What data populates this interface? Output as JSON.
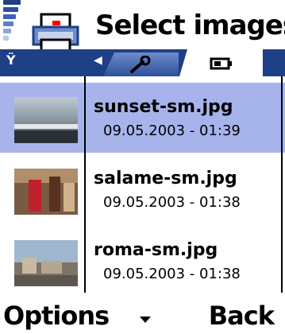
{
  "header": {
    "title": "Select images",
    "app_icon": "printer-icon",
    "signal_level": 0.8
  },
  "tabs": {
    "left_arrow_icon": "arrow-left-icon",
    "items": [
      {
        "icon": "wrench-icon",
        "active": false
      },
      {
        "icon": "battery-icon",
        "active": true
      }
    ]
  },
  "files": [
    {
      "name": "sunset-sm.jpg",
      "datetime": "09.05.2003 - 01:39",
      "selected": true
    },
    {
      "name": "salame-sm.jpg",
      "datetime": "09.05.2003 - 01:38",
      "selected": false
    },
    {
      "name": "roma-sm.jpg",
      "datetime": "09.05.2003 - 01:38",
      "selected": false
    }
  ],
  "softkeys": {
    "left": "Options",
    "right": "Back",
    "middle_icon": "arrow-down-icon"
  },
  "colors": {
    "tab_bar": "#1f3f86",
    "selection": "#a7b4ec",
    "signal": "#3f5fb0"
  }
}
